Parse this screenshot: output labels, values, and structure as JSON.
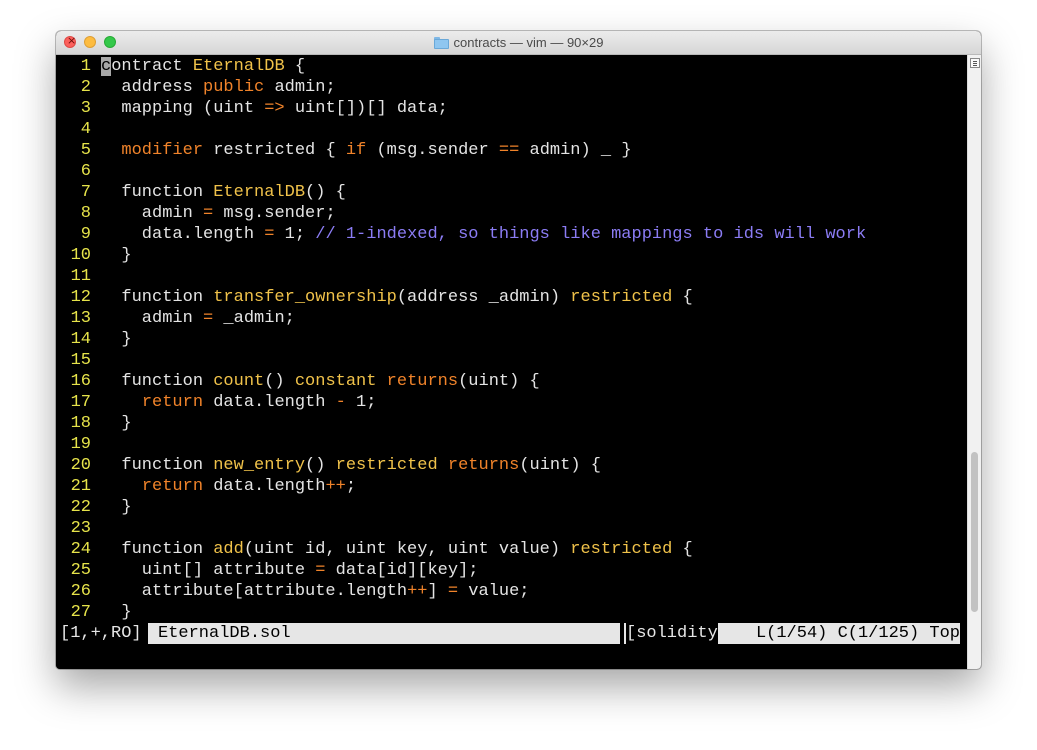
{
  "window": {
    "title": "contracts — vim — 90×29"
  },
  "editor": {
    "lines": [
      {
        "n": "1",
        "tokens": [
          {
            "c": "cursor",
            "t": "c"
          },
          {
            "c": "tok-pl",
            "t": "ontract "
          },
          {
            "c": "tok-ty",
            "t": "EternalDB"
          },
          {
            "c": "tok-pl",
            "t": " {"
          }
        ]
      },
      {
        "n": "2",
        "tokens": [
          {
            "c": "tok-pl",
            "t": "  address "
          },
          {
            "c": "tok-kw",
            "t": "public"
          },
          {
            "c": "tok-pl",
            "t": " admin;"
          }
        ]
      },
      {
        "n": "3",
        "tokens": [
          {
            "c": "tok-pl",
            "t": "  mapping (uint "
          },
          {
            "c": "tok-kw",
            "t": "=>"
          },
          {
            "c": "tok-pl",
            "t": " uint[])[] data;"
          }
        ]
      },
      {
        "n": "4",
        "tokens": []
      },
      {
        "n": "5",
        "tokens": [
          {
            "c": "tok-pl",
            "t": "  "
          },
          {
            "c": "tok-kw",
            "t": "modifier"
          },
          {
            "c": "tok-pl",
            "t": " restricted { "
          },
          {
            "c": "tok-kw",
            "t": "if"
          },
          {
            "c": "tok-pl",
            "t": " (msg.sender "
          },
          {
            "c": "tok-kw",
            "t": "=="
          },
          {
            "c": "tok-pl",
            "t": " admin) _ }"
          }
        ]
      },
      {
        "n": "6",
        "tokens": []
      },
      {
        "n": "7",
        "tokens": [
          {
            "c": "tok-pl",
            "t": "  function "
          },
          {
            "c": "tok-ty",
            "t": "EternalDB"
          },
          {
            "c": "tok-pl",
            "t": "() {"
          }
        ]
      },
      {
        "n": "8",
        "tokens": [
          {
            "c": "tok-pl",
            "t": "    admin "
          },
          {
            "c": "tok-kw",
            "t": "="
          },
          {
            "c": "tok-pl",
            "t": " msg.sender;"
          }
        ]
      },
      {
        "n": "9",
        "tokens": [
          {
            "c": "tok-pl",
            "t": "    data.length "
          },
          {
            "c": "tok-kw",
            "t": "="
          },
          {
            "c": "tok-pl",
            "t": " 1; "
          },
          {
            "c": "tok-cm",
            "t": "// 1-indexed, so things like mappings to ids will work"
          }
        ]
      },
      {
        "n": "10",
        "tokens": [
          {
            "c": "tok-pl",
            "t": "  }"
          }
        ]
      },
      {
        "n": "11",
        "tokens": []
      },
      {
        "n": "12",
        "tokens": [
          {
            "c": "tok-pl",
            "t": "  function "
          },
          {
            "c": "tok-ty",
            "t": "transfer_ownership"
          },
          {
            "c": "tok-pl",
            "t": "(address _admin) "
          },
          {
            "c": "tok-ty",
            "t": "restricted"
          },
          {
            "c": "tok-pl",
            "t": " {"
          }
        ]
      },
      {
        "n": "13",
        "tokens": [
          {
            "c": "tok-pl",
            "t": "    admin "
          },
          {
            "c": "tok-kw",
            "t": "="
          },
          {
            "c": "tok-pl",
            "t": " _admin;"
          }
        ]
      },
      {
        "n": "14",
        "tokens": [
          {
            "c": "tok-pl",
            "t": "  }"
          }
        ]
      },
      {
        "n": "15",
        "tokens": []
      },
      {
        "n": "16",
        "tokens": [
          {
            "c": "tok-pl",
            "t": "  function "
          },
          {
            "c": "tok-ty",
            "t": "count"
          },
          {
            "c": "tok-pl",
            "t": "() "
          },
          {
            "c": "tok-ty",
            "t": "constant"
          },
          {
            "c": "tok-pl",
            "t": " "
          },
          {
            "c": "tok-kw",
            "t": "returns"
          },
          {
            "c": "tok-pl",
            "t": "(uint) {"
          }
        ]
      },
      {
        "n": "17",
        "tokens": [
          {
            "c": "tok-pl",
            "t": "    "
          },
          {
            "c": "tok-kw",
            "t": "return"
          },
          {
            "c": "tok-pl",
            "t": " data.length "
          },
          {
            "c": "tok-kw",
            "t": "-"
          },
          {
            "c": "tok-pl",
            "t": " 1;"
          }
        ]
      },
      {
        "n": "18",
        "tokens": [
          {
            "c": "tok-pl",
            "t": "  }"
          }
        ]
      },
      {
        "n": "19",
        "tokens": []
      },
      {
        "n": "20",
        "tokens": [
          {
            "c": "tok-pl",
            "t": "  function "
          },
          {
            "c": "tok-ty",
            "t": "new_entry"
          },
          {
            "c": "tok-pl",
            "t": "() "
          },
          {
            "c": "tok-ty",
            "t": "restricted"
          },
          {
            "c": "tok-pl",
            "t": " "
          },
          {
            "c": "tok-kw",
            "t": "returns"
          },
          {
            "c": "tok-pl",
            "t": "(uint) {"
          }
        ]
      },
      {
        "n": "21",
        "tokens": [
          {
            "c": "tok-pl",
            "t": "    "
          },
          {
            "c": "tok-kw",
            "t": "return"
          },
          {
            "c": "tok-pl",
            "t": " data.length"
          },
          {
            "c": "tok-kw",
            "t": "++"
          },
          {
            "c": "tok-pl",
            "t": ";"
          }
        ]
      },
      {
        "n": "22",
        "tokens": [
          {
            "c": "tok-pl",
            "t": "  }"
          }
        ]
      },
      {
        "n": "23",
        "tokens": []
      },
      {
        "n": "24",
        "tokens": [
          {
            "c": "tok-pl",
            "t": "  function "
          },
          {
            "c": "tok-ty",
            "t": "add"
          },
          {
            "c": "tok-pl",
            "t": "(uint id, uint key, uint value) "
          },
          {
            "c": "tok-ty",
            "t": "restricted"
          },
          {
            "c": "tok-pl",
            "t": " {"
          }
        ]
      },
      {
        "n": "25",
        "tokens": [
          {
            "c": "tok-pl",
            "t": "    uint[] attribute "
          },
          {
            "c": "tok-kw",
            "t": "="
          },
          {
            "c": "tok-pl",
            "t": " data[id][key];"
          }
        ]
      },
      {
        "n": "26",
        "tokens": [
          {
            "c": "tok-pl",
            "t": "    attribute[attribute.length"
          },
          {
            "c": "tok-kw",
            "t": "++"
          },
          {
            "c": "tok-pl",
            "t": "] "
          },
          {
            "c": "tok-kw",
            "t": "="
          },
          {
            "c": "tok-pl",
            "t": " value;"
          }
        ]
      },
      {
        "n": "27",
        "tokens": [
          {
            "c": "tok-pl",
            "t": "  }"
          }
        ]
      }
    ]
  },
  "statusline": {
    "flags": "[1,+,RO]",
    "filename": "EternalDB.sol",
    "filetype": "[solidity]",
    "position": "L(1/54) C(1/125) Top"
  },
  "colors": {
    "line_number": "#e6e34a",
    "keyword": "#f0832a",
    "type": "#f0c24a",
    "comment": "#8b7cf4"
  }
}
